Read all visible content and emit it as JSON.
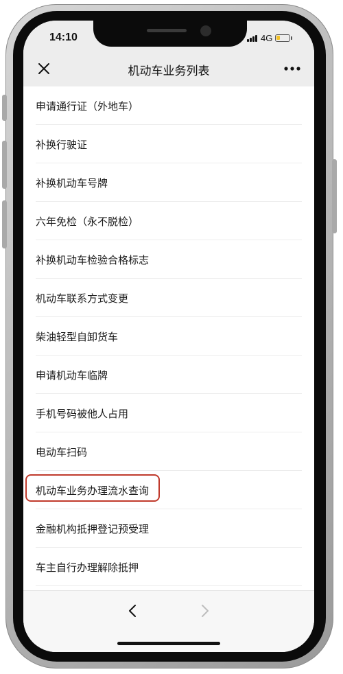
{
  "status_bar": {
    "time": "14:10",
    "network": "4G",
    "signal_bars": 4,
    "battery_level": 0.3,
    "battery_color": "#f2c025"
  },
  "nav": {
    "title": "机动车业务列表",
    "close_icon": "close-icon",
    "more_icon": "more-dots-icon"
  },
  "list": {
    "items": [
      {
        "label": "申请通行证（外地车）"
      },
      {
        "label": "补换行驶证"
      },
      {
        "label": "补换机动车号牌"
      },
      {
        "label": "六年免检（永不脱检）"
      },
      {
        "label": "补换机动车检验合格标志"
      },
      {
        "label": "机动车联系方式变更"
      },
      {
        "label": "柴油轻型自卸货车"
      },
      {
        "label": "申请机动车临牌"
      },
      {
        "label": "手机号码被他人占用"
      },
      {
        "label": "电动车扫码"
      },
      {
        "label": "机动车业务办理流水查询",
        "highlighted": true
      },
      {
        "label": "金融机构抵押登记预受理"
      },
      {
        "label": "车主自行办理解除抵押"
      }
    ],
    "highlight_color": "#c0392b"
  },
  "bottom_bar": {
    "back_icon": "chevron-left-icon",
    "forward_icon": "chevron-right-icon",
    "forward_enabled": false
  }
}
